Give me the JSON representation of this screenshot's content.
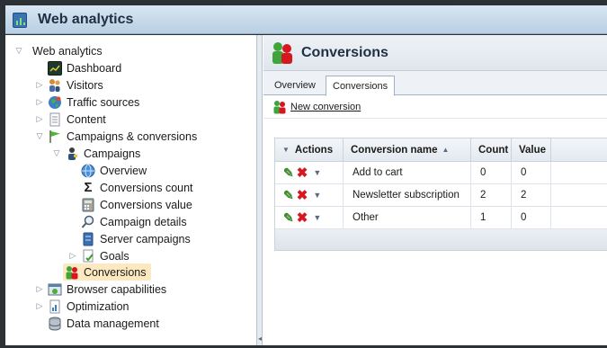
{
  "app": {
    "title": "Web analytics"
  },
  "tree": {
    "items": [
      {
        "label": "Web analytics",
        "icon": "none",
        "level": 0,
        "arrow": "expanded"
      },
      {
        "label": "Dashboard",
        "icon": "dashboard-icon",
        "level": 1,
        "arrow": "none"
      },
      {
        "label": "Visitors",
        "icon": "visitors-icon",
        "level": 1,
        "arrow": "collapsed"
      },
      {
        "label": "Traffic sources",
        "icon": "globe-icon",
        "level": 1,
        "arrow": "collapsed"
      },
      {
        "label": "Content",
        "icon": "document-icon",
        "level": 1,
        "arrow": "collapsed"
      },
      {
        "label": "Campaigns & conversions",
        "icon": "flag-icon",
        "level": 1,
        "arrow": "expanded"
      },
      {
        "label": "Campaigns",
        "icon": "campaign-person-icon",
        "level": 2,
        "arrow": "expanded"
      },
      {
        "label": "Overview",
        "icon": "overview-globe-icon",
        "level": 3,
        "arrow": "none"
      },
      {
        "label": "Conversions count",
        "icon": "sigma-icon",
        "level": 3,
        "arrow": "none"
      },
      {
        "label": "Conversions value",
        "icon": "calculator-icon",
        "level": 3,
        "arrow": "none"
      },
      {
        "label": "Campaign details",
        "icon": "magnifier-icon",
        "level": 3,
        "arrow": "none"
      },
      {
        "label": "Server campaigns",
        "icon": "server-icon",
        "level": 3,
        "arrow": "none"
      },
      {
        "label": "Goals",
        "icon": "goals-icon",
        "level": 3,
        "arrow": "collapsed"
      },
      {
        "label": "Conversions",
        "icon": "conversions-icon",
        "level": 2,
        "arrow": "none",
        "selected": true
      },
      {
        "label": "Browser capabilities",
        "icon": "browser-icon",
        "level": 1,
        "arrow": "collapsed"
      },
      {
        "label": "Optimization",
        "icon": "optimization-icon",
        "level": 1,
        "arrow": "collapsed"
      },
      {
        "label": "Data management",
        "icon": "database-icon",
        "level": 1,
        "arrow": "none"
      }
    ]
  },
  "panel": {
    "title": "Conversions",
    "tabs": [
      {
        "label": "Overview"
      },
      {
        "label": "Conversions",
        "active": true
      }
    ],
    "new_conversion": "New conversion"
  },
  "grid": {
    "columns": {
      "actions": "Actions",
      "name": "Conversion name",
      "count": "Count",
      "value": "Value"
    },
    "sort_indicator": "▲",
    "rows": [
      {
        "name": "Add to cart",
        "count": "0",
        "value": "0"
      },
      {
        "name": "Newsletter subscription",
        "count": "2",
        "value": "2"
      },
      {
        "name": "Other",
        "count": "1",
        "value": "0"
      }
    ]
  },
  "colors": {
    "selected_bg": "#fde9c1",
    "header_gradient": "#b9cfe3",
    "delete_red": "#d7171f",
    "edit_green": "#3e8c2b"
  }
}
